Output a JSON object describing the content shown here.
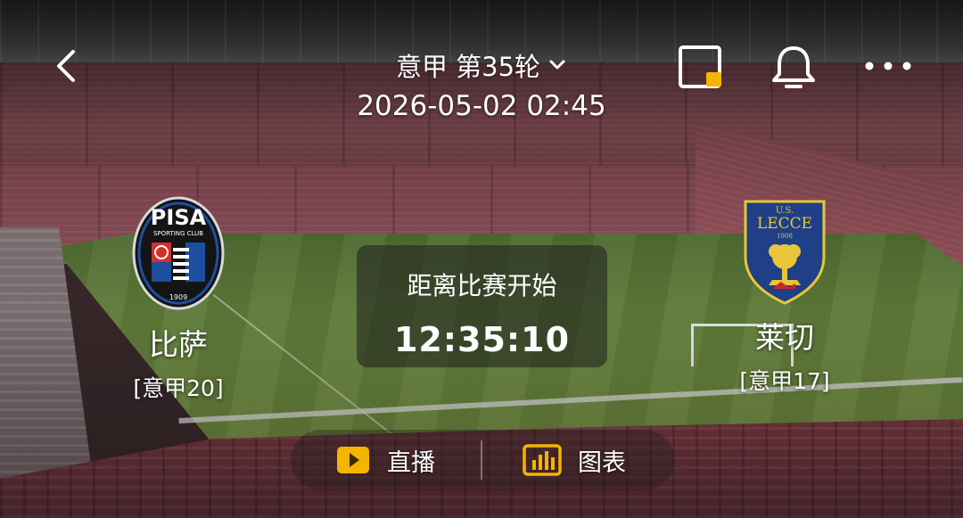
{
  "header": {
    "league_round": "意甲 第35轮",
    "datetime": "2026-05-02 02:45",
    "icons": {
      "back": "back-chevron-icon",
      "dropdown": "chevron-down-icon",
      "pip": "picture-in-picture-icon",
      "notify": "bell-icon",
      "more": "more-dots-icon"
    }
  },
  "home_team": {
    "name": "比萨",
    "rank": "[意甲20]",
    "crest": {
      "icon": "pisa-crest-icon",
      "text": "PISA",
      "subtext": "SPORTING CLUB",
      "year": "1909",
      "colors": [
        "#1a1a1a",
        "#1d4f9e",
        "#d32f2f"
      ]
    }
  },
  "away_team": {
    "name": "莱切",
    "rank": "[意甲17]",
    "crest": {
      "icon": "lecce-crest-icon",
      "text_top": "U.S.",
      "text": "LECCE",
      "year": "1908",
      "colors": [
        "#1f3f86",
        "#e8c63a",
        "#c62828"
      ]
    }
  },
  "countdown": {
    "label": "距离比赛开始",
    "time": "12:35:10"
  },
  "tabs": [
    {
      "label": "直播",
      "icon": "live-play-icon"
    },
    {
      "label": "图表",
      "icon": "bar-chart-icon"
    }
  ],
  "colors": {
    "accent": "#f5b400",
    "text": "#ffffff"
  }
}
